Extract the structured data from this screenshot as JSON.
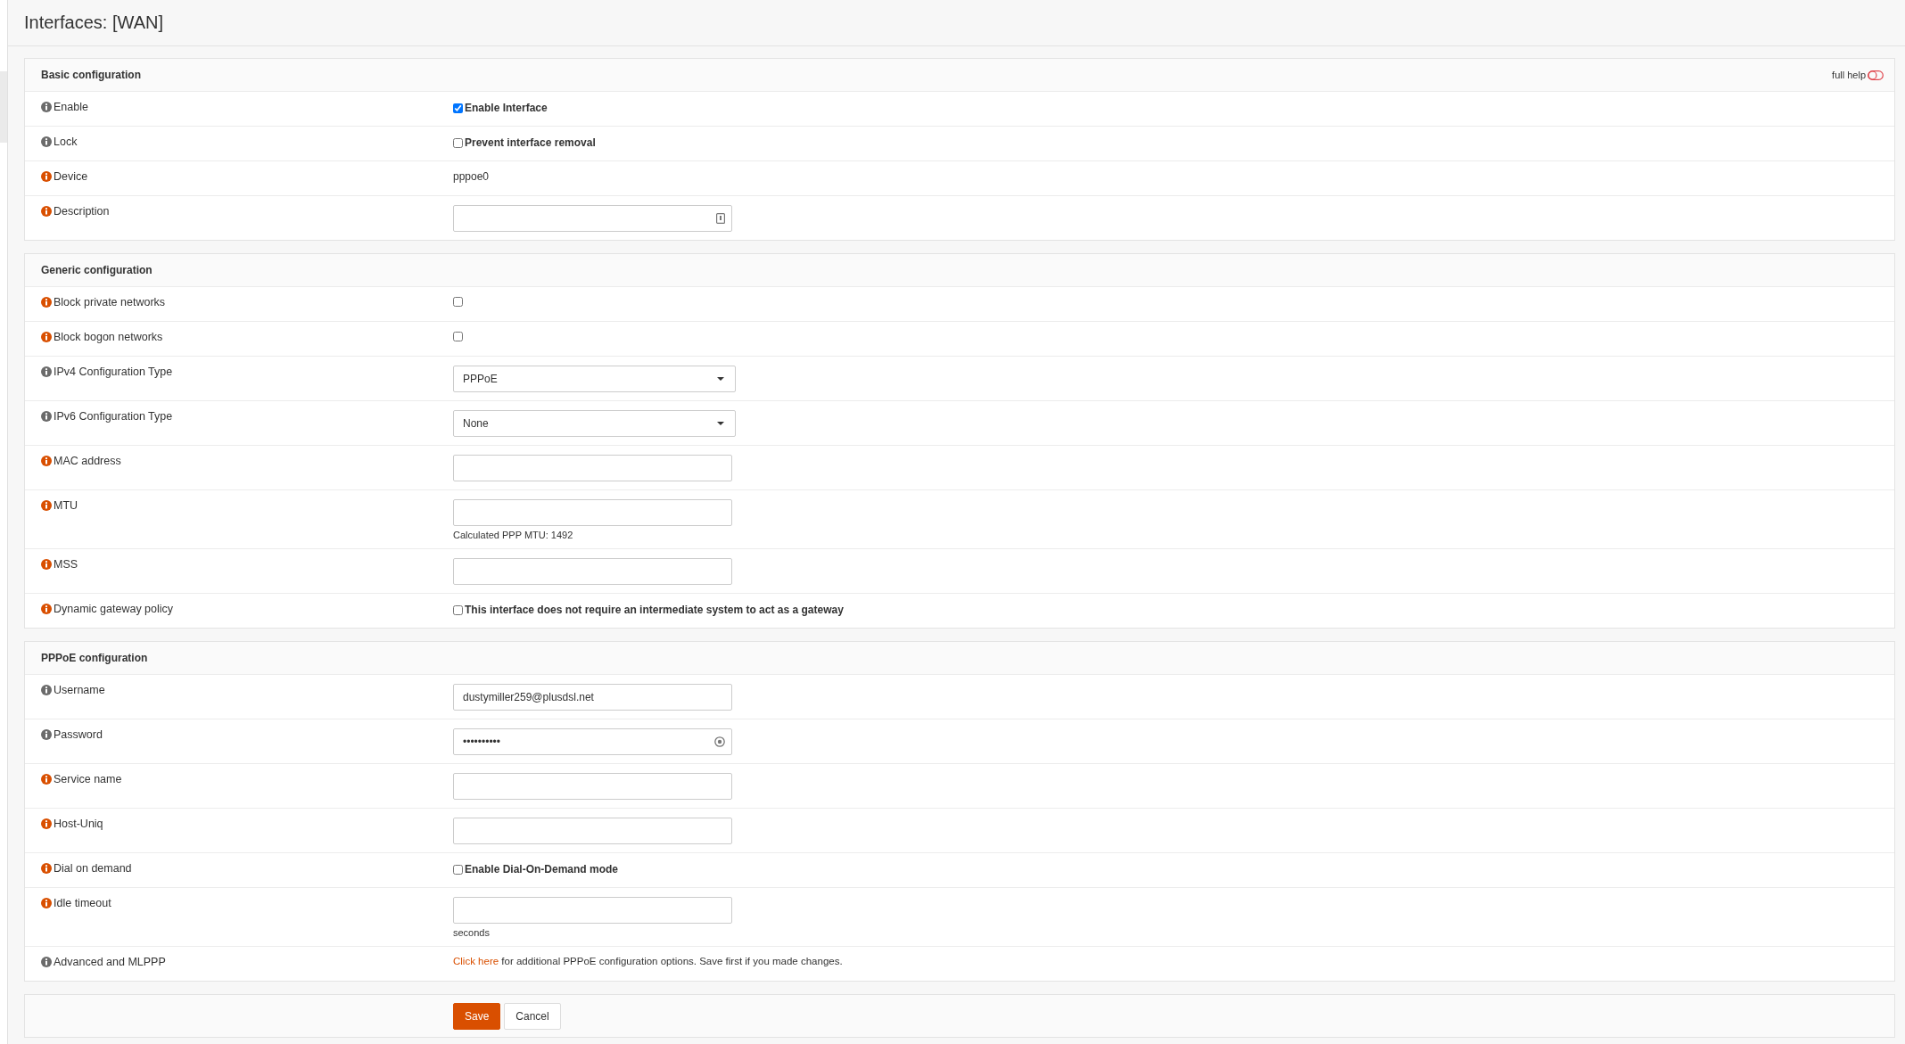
{
  "page_title": "Interfaces: [WAN]",
  "full_help": {
    "label": "full help",
    "on": false
  },
  "sections": [
    {
      "title": "Basic configuration",
      "rows": [
        {
          "label": "Enable",
          "color": "#6b6b6b",
          "kind": "checkbox",
          "checked": true,
          "text": "Enable Interface"
        },
        {
          "label": "Lock",
          "color": "#6b6b6b",
          "kind": "checkbox",
          "checked": false,
          "text": "Prevent interface removal"
        },
        {
          "label": "Device",
          "color": "#d94f00",
          "kind": "static",
          "value": "pppoe0"
        },
        {
          "label": "Description",
          "color": "#d94f00",
          "kind": "note-input"
        }
      ]
    },
    {
      "title": "Generic configuration",
      "rows": [
        {
          "label": "Block private networks",
          "color": "#d94f00",
          "kind": "checkbox",
          "checked": false
        },
        {
          "label": "Block bogon networks",
          "color": "#d94f00",
          "kind": "checkbox",
          "checked": false
        },
        {
          "label": "IPv4 Configuration Type",
          "color": "#6b6b6b",
          "kind": "select",
          "value": "PPPoE"
        },
        {
          "label": "IPv6 Configuration Type",
          "color": "#6b6b6b",
          "kind": "select",
          "value": "None"
        },
        {
          "label": "MAC address",
          "color": "#d94f00",
          "kind": "input"
        },
        {
          "label": "MTU",
          "color": "#d94f00",
          "kind": "input",
          "hint": "Calculated PPP MTU: 1492"
        },
        {
          "label": "MSS",
          "color": "#d94f00",
          "kind": "input"
        },
        {
          "label": "Dynamic gateway policy",
          "color": "#d94f00",
          "kind": "checkbox",
          "checked": false,
          "text": "This interface does not require an intermediate system to act as a gateway"
        }
      ]
    },
    {
      "title": "PPPoE configuration",
      "rows": [
        {
          "label": "Username",
          "color": "#6b6b6b",
          "kind": "input",
          "value": "dustymiller259@plusdsl.net"
        },
        {
          "label": "Password",
          "color": "#6b6b6b",
          "kind": "password",
          "value": "••••••••••"
        },
        {
          "label": "Service name",
          "color": "#d94f00",
          "kind": "input"
        },
        {
          "label": "Host-Uniq",
          "color": "#d94f00",
          "kind": "input"
        },
        {
          "label": "Dial on demand",
          "color": "#d94f00",
          "kind": "checkbox",
          "checked": false,
          "text": "Enable Dial-On-Demand mode"
        },
        {
          "label": "Idle timeout",
          "color": "#d94f00",
          "kind": "input",
          "hint": "seconds"
        },
        {
          "label": "Advanced and MLPPP",
          "color": "#6b6b6b",
          "kind": "link",
          "link": "Click here",
          "text": " for additional PPPoE configuration options. Save first if you made changes."
        }
      ]
    }
  ],
  "buttons": [
    {
      "label": "Save",
      "primary": true
    },
    {
      "label": "Cancel",
      "primary": false
    }
  ]
}
